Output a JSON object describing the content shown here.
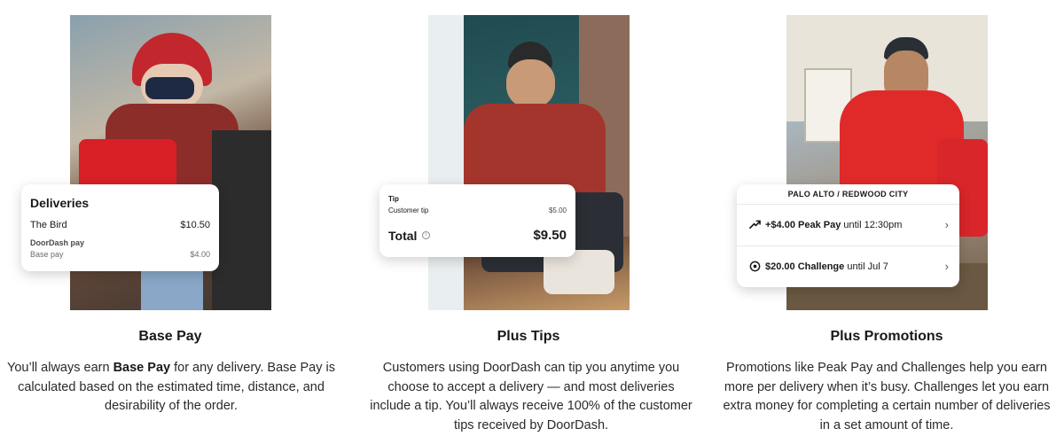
{
  "sections": [
    {
      "heading": "Base Pay",
      "desc_pre": "You’ll always earn ",
      "desc_bold": "Base Pay",
      "desc_post": " for any delivery. Base Pay is calculated based on the estimated time, distance, and desirability of the order.",
      "card": {
        "title": "Deliveries",
        "item": "The Bird",
        "item_amount": "$10.50",
        "subheading": "DoorDash pay",
        "base_label": "Base pay",
        "base_amount": "$4.00"
      }
    },
    {
      "heading": "Plus Tips",
      "desc": "Customers using DoorDash can tip you anytime you choose to accept a delivery — and most deliveries include a tip. You’ll always receive 100% of the customer tips received by DoorDash.",
      "card": {
        "tip_label": "Tip",
        "customer_tip_label": "Customer tip",
        "customer_tip_amount": "$5.00",
        "total_label": "Total",
        "info_glyph": "i",
        "total_amount": "$9.50"
      }
    },
    {
      "heading": "Plus Promotions",
      "desc": "Promotions like Peak Pay and Challenges help you earn more per delivery when it’s busy. Challenges let you earn extra money for completing a certain number of deliveries in a set amount of time.",
      "card": {
        "location": "PALO ALTO / REDWOOD CITY",
        "peak_bold": "+$4.00 Peak Pay",
        "peak_rest": " until 12:30pm",
        "challenge_bold": "$20.00 Challenge",
        "challenge_rest": " until Jul 7",
        "chevron": "›"
      }
    }
  ],
  "icons": {
    "peak": "peak-pay-icon",
    "challenge": "challenge-icon",
    "chevron": "chevron-right-icon",
    "info": "info-icon"
  }
}
